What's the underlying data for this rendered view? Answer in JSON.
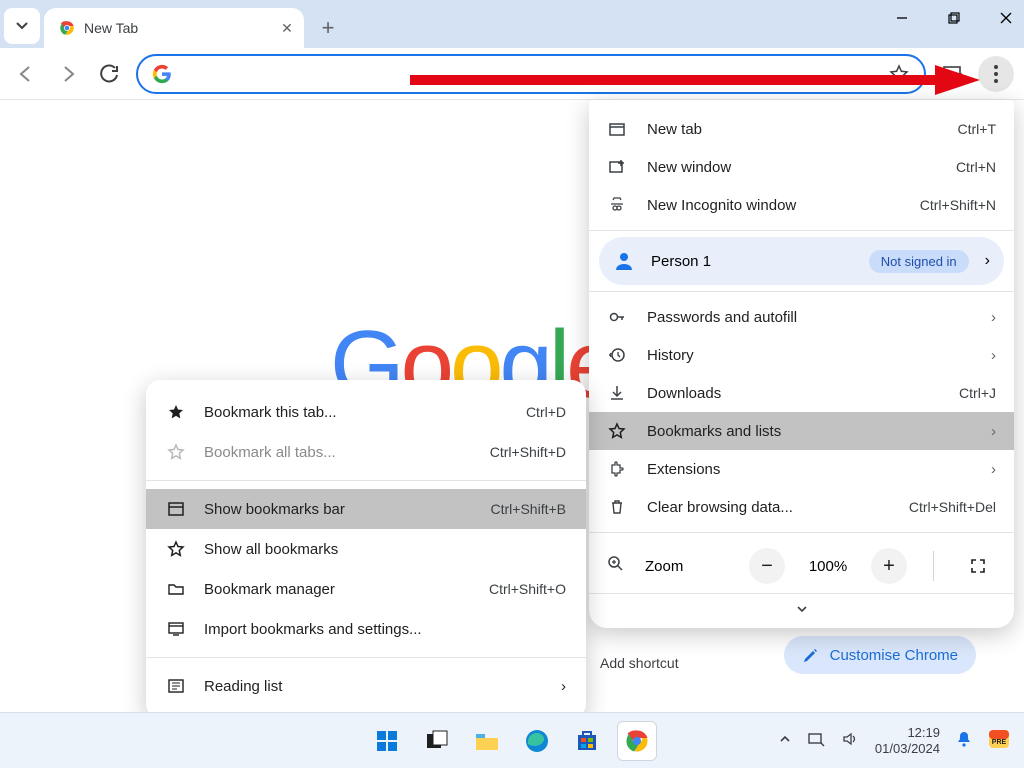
{
  "window": {
    "tab_title": "New Tab",
    "minimize": "—",
    "maximize": "❐",
    "close": "✕"
  },
  "omnibox": {
    "placeholder": ""
  },
  "google_logo_letters": [
    "G",
    "o",
    "o",
    "g",
    "l",
    "e"
  ],
  "bottom": {
    "add_shortcut": "Add shortcut",
    "customise": "Customise Chrome"
  },
  "main_menu": {
    "new_tab": {
      "label": "New tab",
      "shortcut": "Ctrl+T"
    },
    "new_window": {
      "label": "New window",
      "shortcut": "Ctrl+N"
    },
    "incognito": {
      "label": "New Incognito window",
      "shortcut": "Ctrl+Shift+N"
    },
    "profile": {
      "name": "Person 1",
      "badge": "Not signed in"
    },
    "passwords": {
      "label": "Passwords and autofill"
    },
    "history": {
      "label": "History"
    },
    "downloads": {
      "label": "Downloads",
      "shortcut": "Ctrl+J"
    },
    "bookmarks": {
      "label": "Bookmarks and lists"
    },
    "extensions": {
      "label": "Extensions"
    },
    "clear": {
      "label": "Clear browsing data...",
      "shortcut": "Ctrl+Shift+Del"
    },
    "zoom": {
      "label": "Zoom",
      "value": "100%"
    }
  },
  "sub_menu": {
    "bookmark_tab": {
      "label": "Bookmark this tab...",
      "shortcut": "Ctrl+D"
    },
    "bookmark_all": {
      "label": "Bookmark all tabs...",
      "shortcut": "Ctrl+Shift+D"
    },
    "show_bar": {
      "label": "Show bookmarks bar",
      "shortcut": "Ctrl+Shift+B"
    },
    "show_all": {
      "label": "Show all bookmarks"
    },
    "manager": {
      "label": "Bookmark manager",
      "shortcut": "Ctrl+Shift+O"
    },
    "import": {
      "label": "Import bookmarks and settings..."
    },
    "reading": {
      "label": "Reading list"
    }
  },
  "tray": {
    "time": "12:19",
    "date": "01/03/2024"
  }
}
